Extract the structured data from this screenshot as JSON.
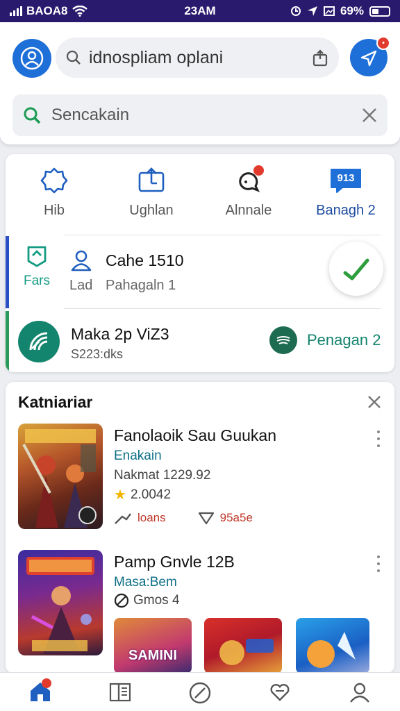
{
  "status_bar": {
    "carrier": "BAOA8",
    "time": "23AM",
    "battery": "69%"
  },
  "header": {
    "top_search_text": "idnospliam oplani",
    "search_placeholder": "Sencakain"
  },
  "quick_actions": [
    {
      "label": "Hib",
      "icon": "gear-badge-icon",
      "active": false
    },
    {
      "label": "Ughlan",
      "icon": "upload-board-icon",
      "active": false
    },
    {
      "label": "Alnnale",
      "icon": "headset-chat-icon",
      "active": false,
      "badge": true
    },
    {
      "label": "Banagh 2",
      "icon": "chat-bubble-icon",
      "active": true,
      "bubble_text": "913"
    }
  ],
  "side_tab": {
    "label": "Fars",
    "icon": "map-pin-icon"
  },
  "cache_row": {
    "title": "Cahe 1510",
    "sub_left": "Lad",
    "sub_right": "Pahagaln 1"
  },
  "map_row": {
    "title": "Maka 2p ViZ3",
    "subtitle": "S223:dks",
    "action_label": "Penagan 2"
  },
  "category": {
    "title": "Katniariar",
    "apps": [
      {
        "name": "Fanolaoik Sau Guukan",
        "developer": "Enakain",
        "meta": "Nakmat 1229.92",
        "rating": "2.0042",
        "action_left": "loans",
        "action_right": "95a5e"
      },
      {
        "name": "Pamp Gnvle 12B",
        "developer": "Masa:Bem",
        "meta": "Gmos 4"
      }
    ],
    "mini_apps": [
      {
        "label": "SAMINI"
      },
      {
        "label": ""
      },
      {
        "label": ""
      }
    ]
  },
  "bottom_nav": [
    {
      "icon": "home-icon",
      "active": true
    },
    {
      "icon": "book-icon",
      "active": false
    },
    {
      "icon": "slash-circle-icon",
      "active": false
    },
    {
      "icon": "heart-chat-icon",
      "active": false
    },
    {
      "icon": "profile-icon",
      "active": false
    }
  ],
  "colors": {
    "accent": "#1f6fd8",
    "teal": "#13846e",
    "status_bg": "#2a1a6e",
    "badge": "#e23b2e"
  }
}
